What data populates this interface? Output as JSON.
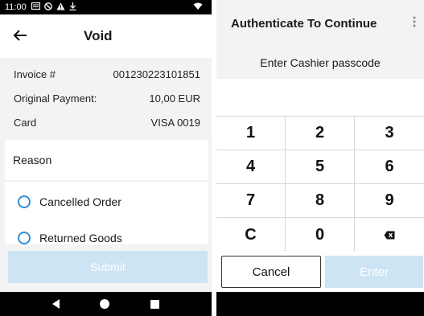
{
  "status_bar": {
    "time": "11:00",
    "icons": [
      "notification-icon",
      "do-not-disturb-icon",
      "warning-icon",
      "download-icon"
    ],
    "right_icons": [
      "wifi-icon"
    ]
  },
  "void_screen": {
    "back_icon": "back-arrow-icon",
    "title": "Void",
    "details": [
      {
        "label": "Invoice #",
        "value": "001230223101851"
      },
      {
        "label": "Original Payment:",
        "value": "10,00 EUR"
      },
      {
        "label": "Card",
        "value": "VISA 0019"
      }
    ],
    "reason_heading": "Reason",
    "reasons": [
      {
        "label": "Cancelled Order",
        "selected": false
      },
      {
        "label": "Returned Goods",
        "selected": false
      }
    ],
    "submit_label": "Submit",
    "nav_icons": [
      "nav-back-icon",
      "nav-home-icon",
      "nav-recent-icon"
    ]
  },
  "auth_dialog": {
    "title": "Authenticate To Continue",
    "menu_icon": "more-vertical-icon",
    "prompt": "Enter Cashier passcode",
    "keys": [
      "1",
      "2",
      "3",
      "4",
      "5",
      "6",
      "7",
      "8",
      "9",
      "C",
      "0",
      "⌫"
    ],
    "cancel_label": "Cancel",
    "enter_label": "Enter"
  },
  "colors": {
    "accent_radio": "#2f8fd6",
    "disabled_button": "#cde4f4",
    "panel_bg": "#f3f3f3"
  }
}
